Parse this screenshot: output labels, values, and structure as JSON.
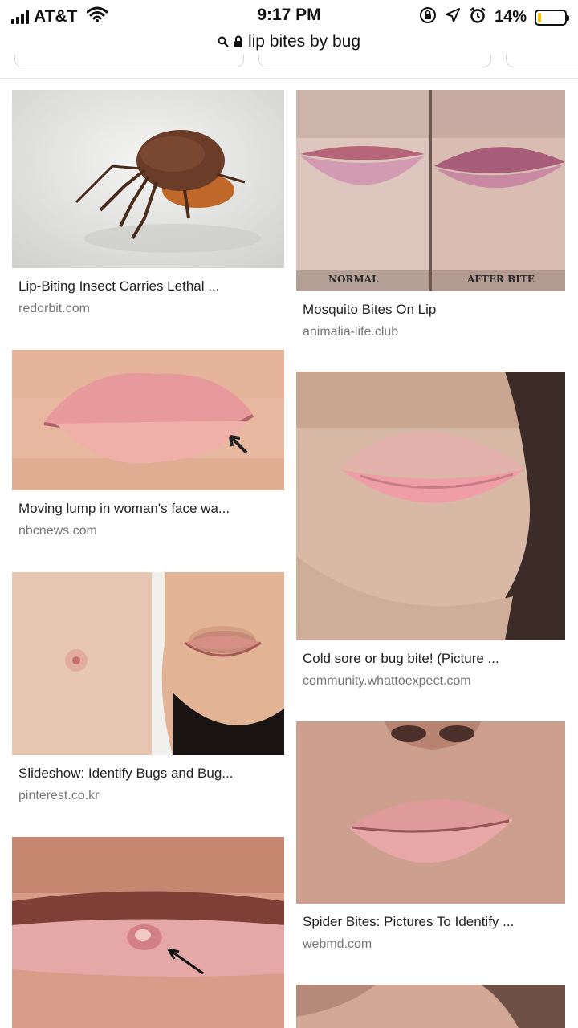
{
  "status_bar": {
    "carrier": "AT&T",
    "time": "9:17 PM",
    "battery_percent": "14%",
    "battery_level": 0.14,
    "icons": [
      "signal-icon",
      "wifi-icon",
      "orientation-lock-icon",
      "location-icon",
      "alarm-icon",
      "battery-icon"
    ]
  },
  "browser": {
    "url": "lip bites by bug",
    "icons": [
      "search-icon",
      "lock-icon"
    ]
  },
  "results": {
    "left": [
      {
        "title": "Lip-Biting Insect Carries Lethal ...",
        "source": "redorbit.com"
      },
      {
        "title": "Moving lump in woman's face wa...",
        "source": "nbcnews.com"
      },
      {
        "title": "Slideshow: Identify Bugs and Bug...",
        "source": "pinterest.co.kr"
      }
    ],
    "right": [
      {
        "title": "Mosquito Bites On Lip",
        "source": "animalia-life.club",
        "labels": [
          "NORMAL",
          "AFTER BITE"
        ]
      },
      {
        "title": "Cold sore or bug bite! (Picture ...",
        "source": "community.whattoexpect.com"
      },
      {
        "title": "Spider Bites: Pictures To Identify ...",
        "source": "webmd.com"
      }
    ]
  },
  "colors": {
    "battery_fill": "#f5c400",
    "title_text": "#222222",
    "source_text": "#777777"
  }
}
